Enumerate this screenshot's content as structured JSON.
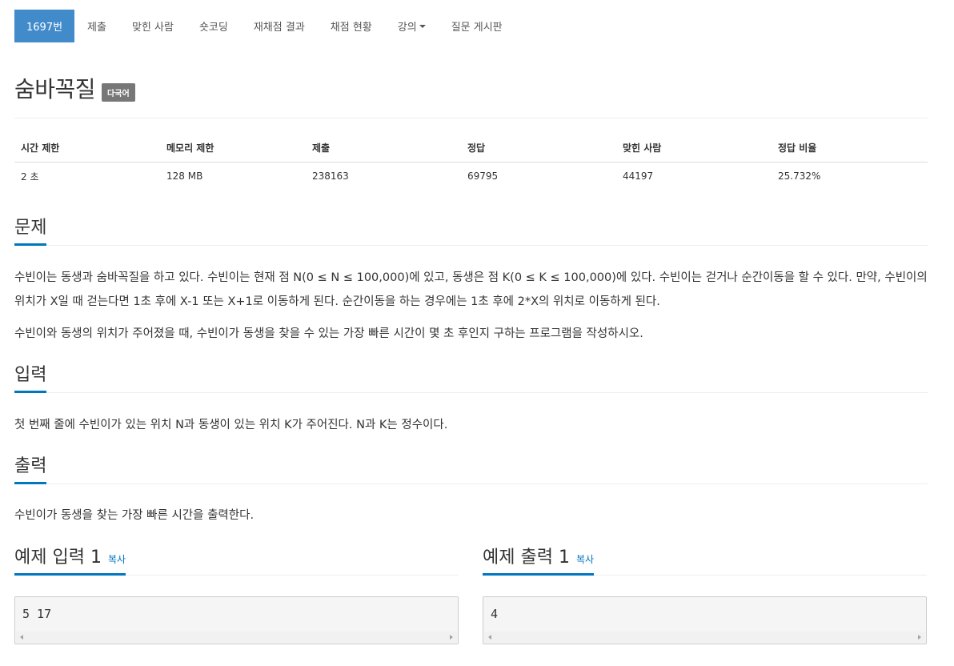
{
  "nav": {
    "items": [
      {
        "label": "1697번",
        "active": true
      },
      {
        "label": "제출"
      },
      {
        "label": "맞힌 사람"
      },
      {
        "label": "숏코딩"
      },
      {
        "label": "재채점 결과"
      },
      {
        "label": "채점 현황"
      },
      {
        "label": "강의",
        "dropdown": true
      },
      {
        "label": "질문 게시판"
      }
    ]
  },
  "problem": {
    "title": "숨바꼭질",
    "badge": "다국어"
  },
  "info": {
    "headers": [
      "시간 제한",
      "메모리 제한",
      "제출",
      "정답",
      "맞힌 사람",
      "정답 비율"
    ],
    "values": [
      "2 초",
      "128 MB",
      "238163",
      "69795",
      "44197",
      "25.732%"
    ]
  },
  "sections": {
    "description": {
      "heading": "문제",
      "p1": "수빈이는 동생과 숨바꼭질을 하고 있다. 수빈이는 현재 점 N(0 ≤ N ≤ 100,000)에 있고, 동생은 점 K(0 ≤ K ≤ 100,000)에 있다. 수빈이는 걷거나 순간이동을 할 수 있다. 만약, 수빈이의 위치가 X일 때 걷는다면 1초 후에 X-1 또는 X+1로 이동하게 된다. 순간이동을 하는 경우에는 1초 후에 2*X의 위치로 이동하게 된다.",
      "p2": "수빈이와 동생의 위치가 주어졌을 때, 수빈이가 동생을 찾을 수 있는 가장 빠른 시간이 몇 초 후인지 구하는 프로그램을 작성하시오."
    },
    "input": {
      "heading": "입력",
      "text": "첫 번째 줄에 수빈이가 있는 위치 N과 동생이 있는 위치 K가 주어진다. N과 K는 정수이다."
    },
    "output": {
      "heading": "출력",
      "text": "수빈이가 동생을 찾는 가장 빠른 시간을 출력한다."
    },
    "sample_input": {
      "heading": "예제 입력 1",
      "copy": "복사",
      "code": "5 17"
    },
    "sample_output": {
      "heading": "예제 출력 1",
      "copy": "복사",
      "code": "4"
    }
  },
  "colors": {
    "accent": "#428bca",
    "underline": "#0076c0",
    "badge": "#777777"
  }
}
